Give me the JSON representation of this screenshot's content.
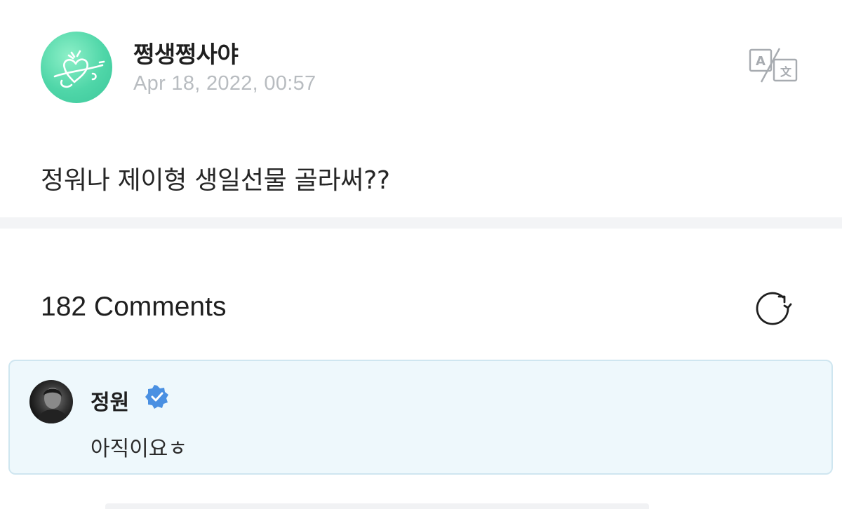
{
  "post": {
    "author": "쩡생쩡사야",
    "date": "Apr 18, 2022, 00:57",
    "body": "정워나 제이형 생일선물 골라써??",
    "translate_icon": "translate-icon"
  },
  "comments": {
    "title": "182 Comments",
    "refresh_icon": "refresh-icon",
    "items": [
      {
        "name": "정원",
        "verified": true,
        "text": "아직이요ㅎ"
      }
    ]
  },
  "colors": {
    "avatar_green": "#4fd6a8",
    "highlight_bg": "#eef8fc",
    "highlight_border": "#cfe6f0",
    "verified_blue": "#4a90e2",
    "date_gray": "#b8bcc0"
  }
}
